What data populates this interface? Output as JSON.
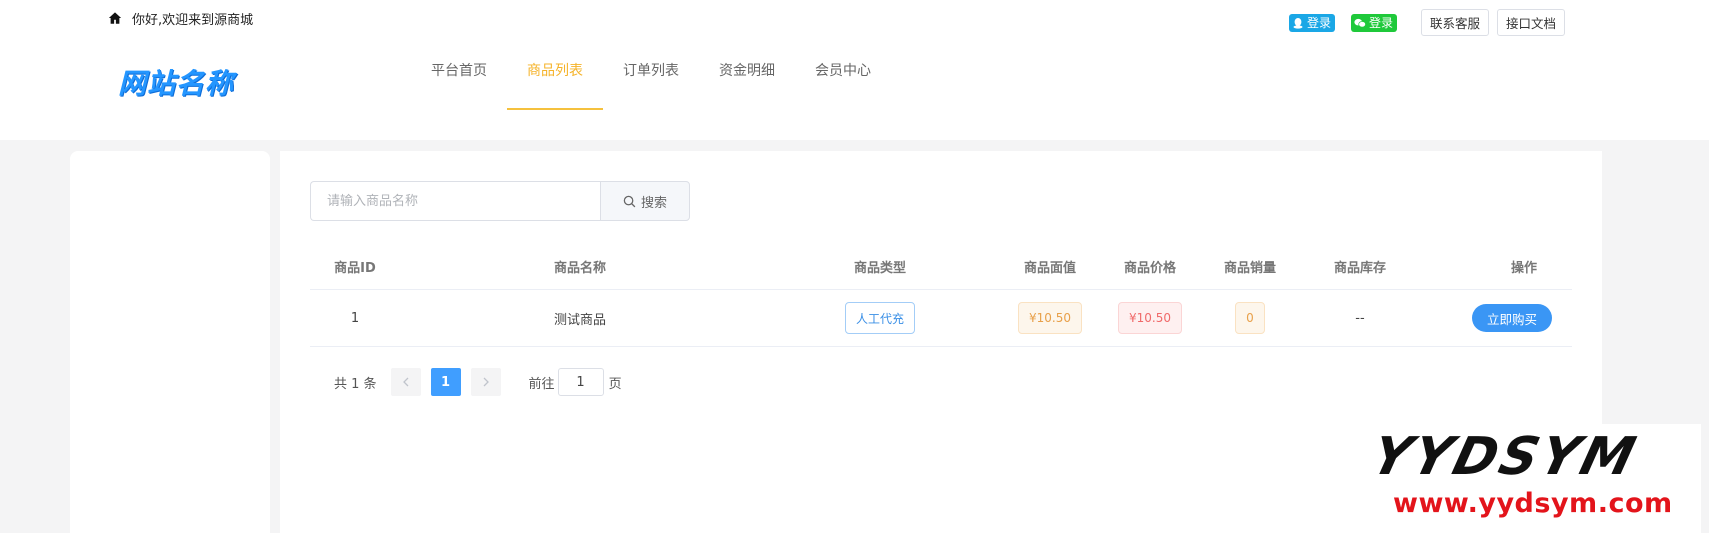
{
  "header": {
    "greeting": "你好,欢迎来到源商城",
    "qq_login": "登录",
    "wechat_login": "登录",
    "contact": "联系客服",
    "api_docs": "接口文档",
    "logo_text": "网站名称"
  },
  "nav": {
    "items": [
      "平台首页",
      "商品列表",
      "订单列表",
      "资金明细",
      "会员中心"
    ],
    "active_index": 1
  },
  "search": {
    "placeholder": "请输入商品名称",
    "button": "搜索"
  },
  "table": {
    "columns": [
      "商品ID",
      "商品名称",
      "商品类型",
      "商品面值",
      "商品价格",
      "商品销量",
      "商品库存",
      "操作"
    ],
    "rows": [
      {
        "id": "1",
        "name": "测试商品",
        "type": "人工代充",
        "face_value": "¥10.50",
        "price": "¥10.50",
        "sales": "0",
        "stock": "--",
        "action": "立即购买"
      }
    ]
  },
  "pagination": {
    "total_text": "共 1 条",
    "current_page": "1",
    "goto_prefix": "前往",
    "goto_value": "1",
    "goto_suffix": "页"
  },
  "watermark": {
    "title": "YYDSYM",
    "url": "www.yydsym.com"
  },
  "colors": {
    "accent": "#f5b32a",
    "primary": "#409eff",
    "qq": "#1aa7e6",
    "wechat": "#1fc93a"
  }
}
